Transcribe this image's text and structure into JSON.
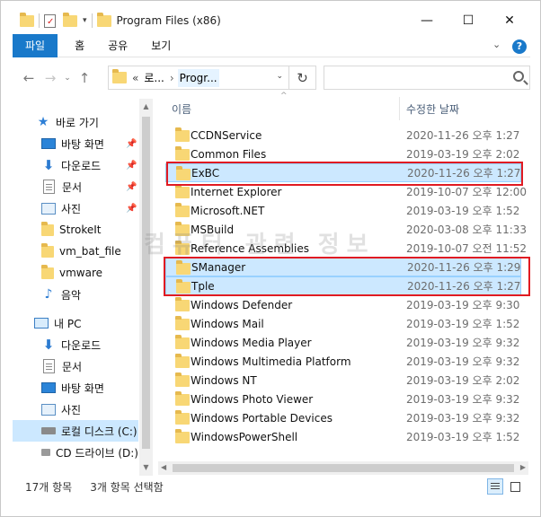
{
  "window": {
    "title": "Program Files (x86)",
    "controls": {
      "minimize": "—",
      "maximize": "☐",
      "close": "✕"
    }
  },
  "ribbon": {
    "tabs": [
      {
        "label": "파일",
        "active": true
      },
      {
        "label": "홈",
        "active": false
      },
      {
        "label": "공유",
        "active": false
      },
      {
        "label": "보기",
        "active": false
      }
    ],
    "help": "?"
  },
  "address": {
    "overflow": "«",
    "segments": [
      "로...",
      "Progr..."
    ],
    "separator": "›",
    "search_placeholder": ""
  },
  "sidebar": {
    "items": [
      {
        "label": "바로 가기",
        "icon": "star-icon",
        "pinned": false
      },
      {
        "label": "바탕 화면",
        "icon": "desktop-icon",
        "pinned": true
      },
      {
        "label": "다운로드",
        "icon": "download-icon",
        "pinned": true
      },
      {
        "label": "문서",
        "icon": "document-icon",
        "pinned": true
      },
      {
        "label": "사진",
        "icon": "picture-icon",
        "pinned": true
      },
      {
        "label": "StrokeIt",
        "icon": "folder-icon",
        "pinned": false
      },
      {
        "label": "vm_bat_file",
        "icon": "folder-icon",
        "pinned": false
      },
      {
        "label": "vmware",
        "icon": "folder-icon",
        "pinned": false
      },
      {
        "label": "음악",
        "icon": "music-icon",
        "pinned": false
      },
      {
        "label": "내 PC",
        "icon": "pc-icon",
        "pinned": false
      },
      {
        "label": "다운로드",
        "icon": "download-icon",
        "pinned": false
      },
      {
        "label": "문서",
        "icon": "document-icon",
        "pinned": false
      },
      {
        "label": "바탕 화면",
        "icon": "desktop-icon",
        "pinned": false
      },
      {
        "label": "사진",
        "icon": "picture-icon",
        "pinned": false
      },
      {
        "label": "로컬 디스크 (C:)",
        "icon": "drive-icon",
        "pinned": false,
        "selected": true
      },
      {
        "label": "CD 드라이브 (D:)",
        "icon": "cd-drive-icon",
        "pinned": false
      }
    ]
  },
  "columns": {
    "name": "이름",
    "date": "수정한 날짜"
  },
  "files": [
    {
      "name": "CCDNService",
      "date": "2020-11-26 오후 1:27",
      "selected": false
    },
    {
      "name": "Common Files",
      "date": "2019-03-19 오후 2:02",
      "selected": false
    },
    {
      "name": "ExBC",
      "date": "2020-11-26 오후 1:27",
      "selected": true
    },
    {
      "name": "Internet Explorer",
      "date": "2019-10-07 오후 12:00",
      "selected": false
    },
    {
      "name": "Microsoft.NET",
      "date": "2019-03-19 오후 1:52",
      "selected": false
    },
    {
      "name": "MSBuild",
      "date": "2020-03-08 오후 11:33",
      "selected": false
    },
    {
      "name": "Reference Assemblies",
      "date": "2019-10-07 오전 11:52",
      "selected": false
    },
    {
      "name": "SManager",
      "date": "2020-11-26 오후 1:29",
      "selected": true
    },
    {
      "name": "Tple",
      "date": "2020-11-26 오후 1:27",
      "selected": true
    },
    {
      "name": "Windows Defender",
      "date": "2019-03-19 오후 9:30",
      "selected": false
    },
    {
      "name": "Windows Mail",
      "date": "2019-03-19 오후 1:52",
      "selected": false
    },
    {
      "name": "Windows Media Player",
      "date": "2019-03-19 오후 9:32",
      "selected": false
    },
    {
      "name": "Windows Multimedia Platform",
      "date": "2019-03-19 오후 9:32",
      "selected": false
    },
    {
      "name": "Windows NT",
      "date": "2019-03-19 오후 2:02",
      "selected": false
    },
    {
      "name": "Windows Photo Viewer",
      "date": "2019-03-19 오후 9:32",
      "selected": false
    },
    {
      "name": "Windows Portable Devices",
      "date": "2019-03-19 오후 9:32",
      "selected": false
    },
    {
      "name": "WindowsPowerShell",
      "date": "2019-03-19 오후 1:52",
      "selected": false
    }
  ],
  "status": {
    "item_count": "17개 항목",
    "selected_count": "3개 항목 선택함"
  },
  "watermark": "컴퓨터 관련 정보",
  "colors": {
    "accent": "#1979ca",
    "selection": "#cce8ff",
    "highlight_box": "#e01b22",
    "folder": "#f8d775"
  }
}
